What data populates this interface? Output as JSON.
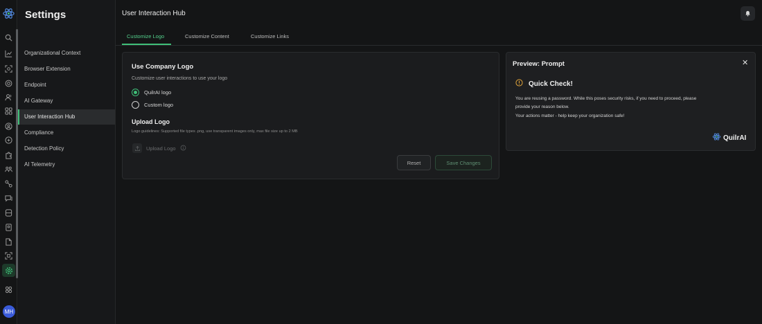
{
  "sidebar": {
    "title": "Settings",
    "items": [
      {
        "label": "Organizational Context"
      },
      {
        "label": "Browser Extension"
      },
      {
        "label": "Endpoint"
      },
      {
        "label": "AI Gateway"
      },
      {
        "label": "User Interaction Hub",
        "active": true
      },
      {
        "label": "Compliance"
      },
      {
        "label": "Detection Policy"
      },
      {
        "label": "AI Telemetry"
      }
    ]
  },
  "rail": {
    "icons": [
      "search-icon",
      "chart-icon",
      "scan-icon",
      "target-icon",
      "users-icon",
      "apps-icon",
      "user-circle-icon",
      "shield-icon",
      "puzzle-icon",
      "team-icon",
      "link-icon",
      "chat-icon",
      "database-icon",
      "badge-icon",
      "file-icon",
      "frame-icon",
      "settings-icon"
    ],
    "grid_icon": "grid-icon",
    "avatar_initials": "MH"
  },
  "header": {
    "title": "User Interaction Hub",
    "bell_icon": "bell-icon"
  },
  "tabs": [
    {
      "label": "Customize Logo",
      "active": true
    },
    {
      "label": "Customize Content"
    },
    {
      "label": "Customize Links"
    }
  ],
  "logo_card": {
    "title": "Use Company Logo",
    "subtitle": "Customize user interactions to use your logo",
    "options": [
      {
        "label": "QuilrAI logo",
        "checked": true
      },
      {
        "label": "Custom logo",
        "checked": false
      }
    ],
    "upload_title": "Upload Logo",
    "guidelines": "Logo guidelines: Supported file types .png, use transparent images only, max file size up to 2 MB",
    "upload_label": "Upload Logo",
    "reset_label": "Reset",
    "save_label": "Save Changes"
  },
  "preview": {
    "title": "Preview: Prompt",
    "heading": "Quick Check!",
    "line1": "You are reusing a password. While this poses security risks, if you need to proceed, please",
    "line2": "provide your reason below.",
    "line3": "Your actions matter - help keep your organization safe!",
    "brand": "QuilrAI"
  },
  "colors": {
    "accent": "#3fbf78",
    "background": "#141516",
    "card": "#1b1c1e",
    "warning": "#e0a43a"
  }
}
